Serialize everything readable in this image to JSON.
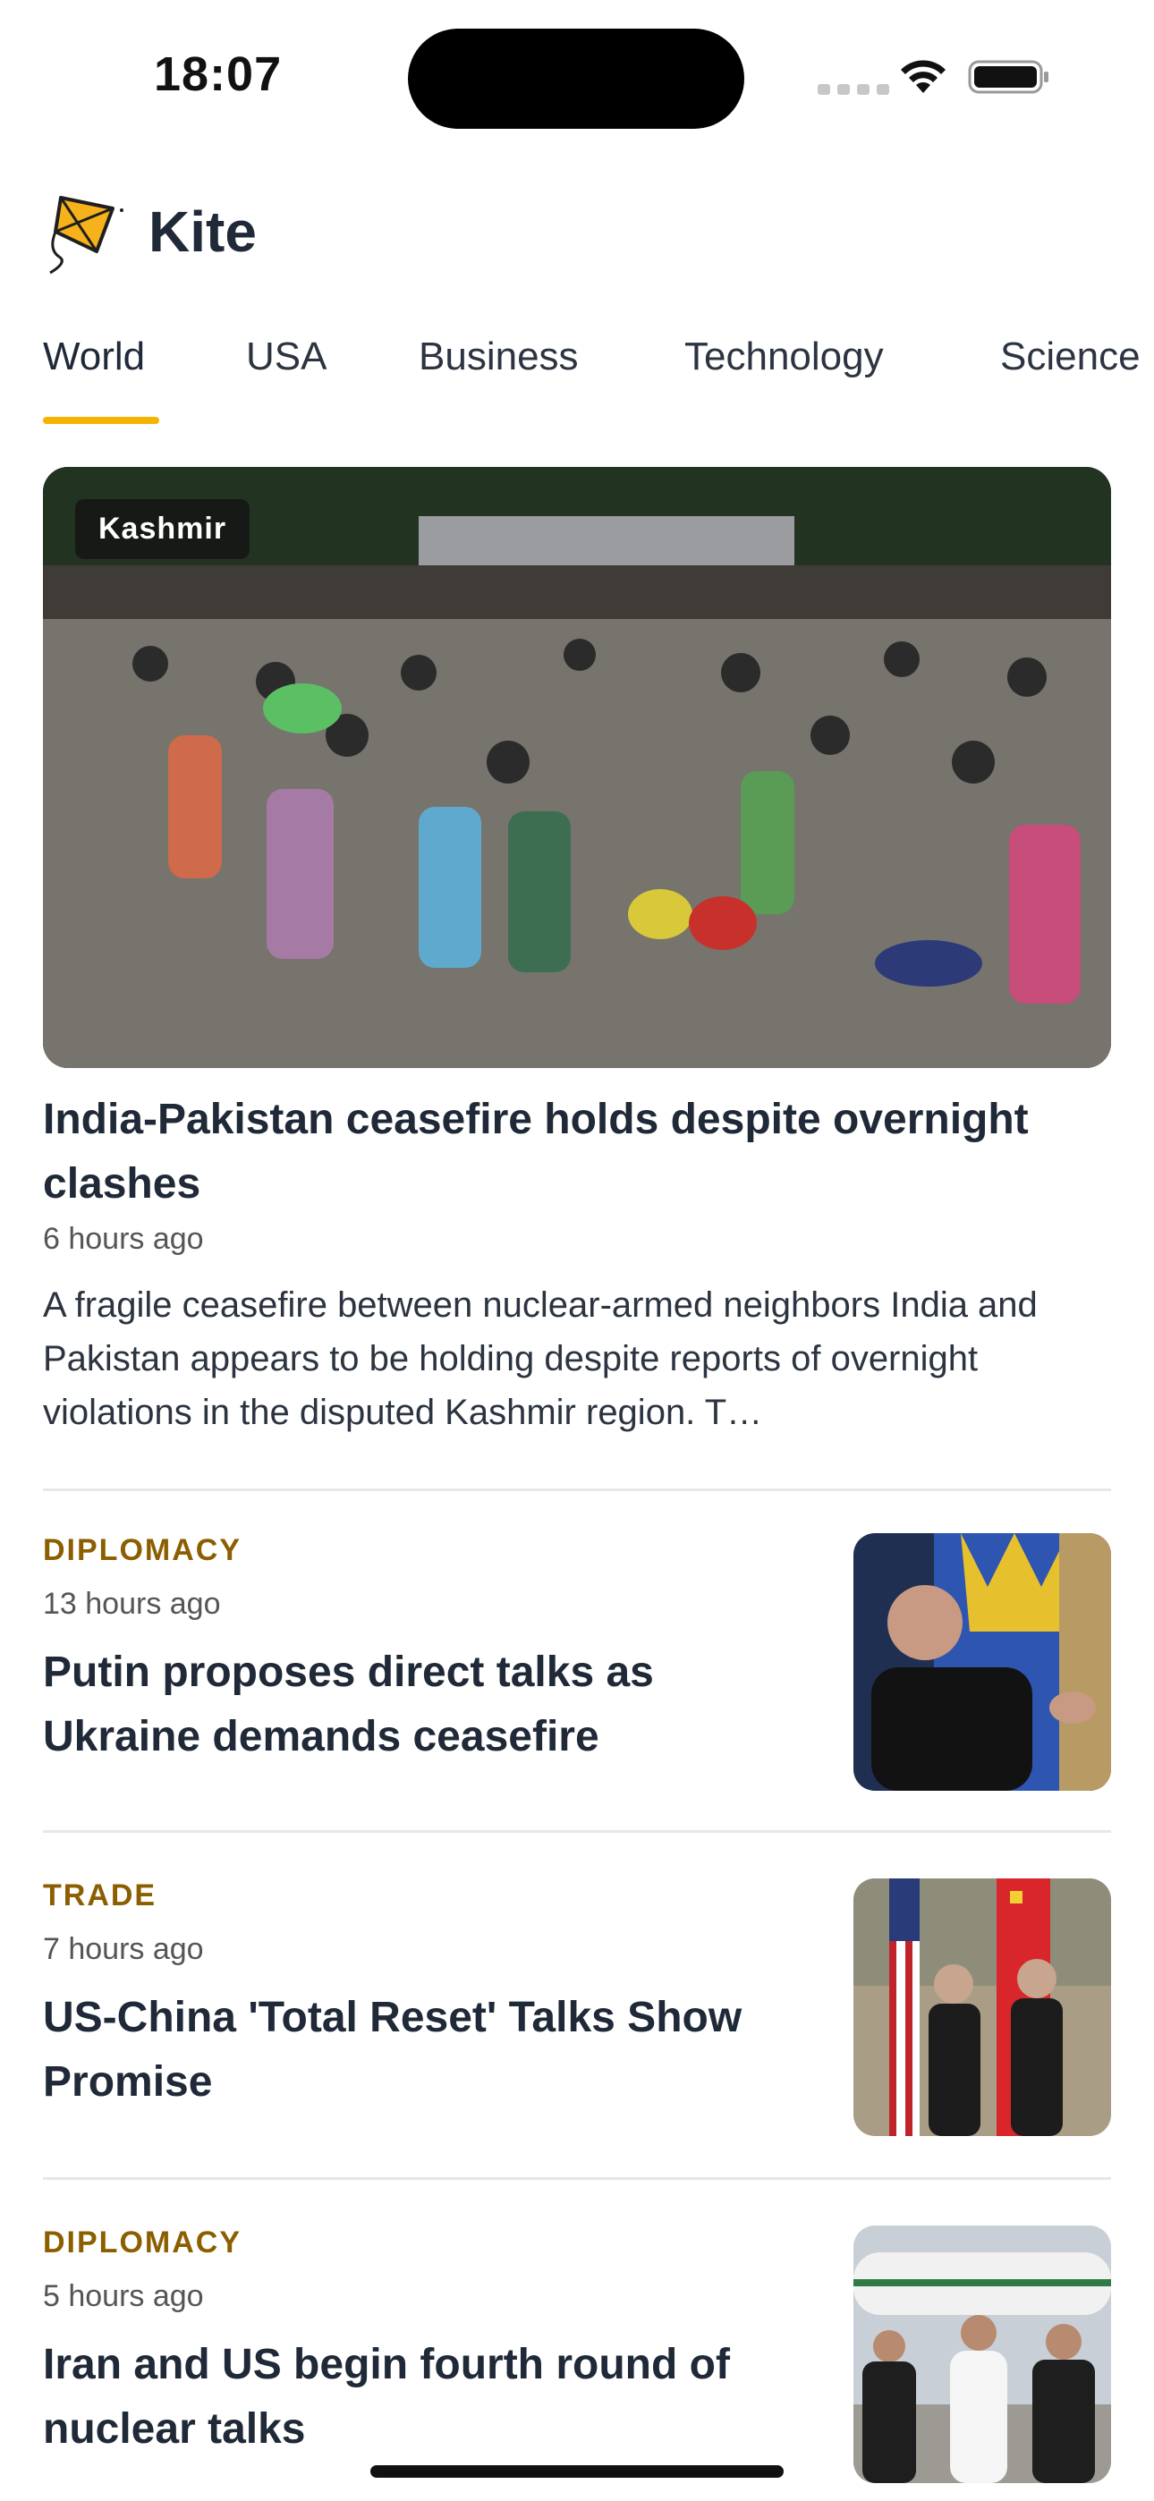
{
  "status_bar": {
    "time": "18:07"
  },
  "app": {
    "title": "Kite"
  },
  "tabs": [
    {
      "label": "World",
      "active": true
    },
    {
      "label": "USA",
      "active": false
    },
    {
      "label": "Business",
      "active": false
    },
    {
      "label": "Technology",
      "active": false
    },
    {
      "label": "Science",
      "active": false
    }
  ],
  "hero": {
    "tag": "Kashmir",
    "title": "India-Pakistan ceasefire holds despite overnight clashes",
    "time": "6 hours ago",
    "summary": "A fragile ceasefire between nuclear-armed neighbors India and Pakistan appears to be holding despite reports of overnight violations in the disputed Kashmir region. T…"
  },
  "stories": [
    {
      "category": "DIPLOMACY",
      "time": "13 hours ago",
      "title": "Putin proposes direct talks as Ukraine demands ceasefire"
    },
    {
      "category": "TRADE",
      "time": "7 hours ago",
      "title": "US-China 'Total Reset' Talks Show Promise"
    },
    {
      "category": "DIPLOMACY",
      "time": "5 hours ago",
      "title": "Iran and US begin fourth round of nuclear talks"
    }
  ],
  "colors": {
    "accent": "#f4b400",
    "category": "#8b5e00",
    "text": "#1f2937"
  },
  "icons": {
    "logo": "kite-logo-icon",
    "wifi": "wifi-icon",
    "battery": "battery-icon",
    "signal": "cellular-signal-icon"
  }
}
